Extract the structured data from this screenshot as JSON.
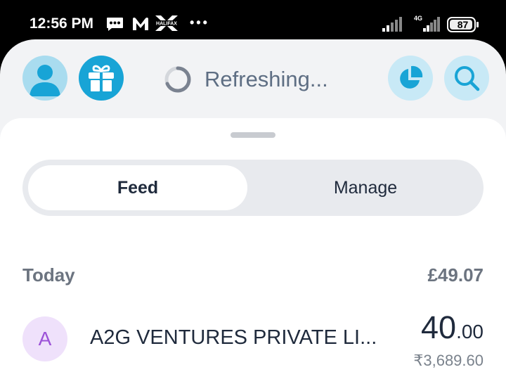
{
  "status_bar": {
    "time": "12:56 PM",
    "battery_level": "87",
    "network_type": "4G",
    "icons": [
      "message-icon",
      "m-app-icon",
      "halifax-icon",
      "more-dots-icon",
      "signal-icon",
      "signal-4g-icon",
      "battery-icon"
    ],
    "halifax_label": "HALIFAX",
    "more_label": "•••"
  },
  "header": {
    "refresh_text": "Refreshing...",
    "icons": [
      "profile-icon",
      "gift-icon",
      "spinner-icon",
      "insights-pie-icon",
      "search-icon"
    ]
  },
  "tabs": {
    "feed": "Feed",
    "manage": "Manage",
    "selected": "Feed"
  },
  "feed": {
    "section_label": "Today",
    "section_total": "£49.07",
    "transactions": [
      {
        "avatar_letter": "A",
        "name": "A2G VENTURES PRIVATE LI...",
        "amount_major": "40",
        "amount_minor": ".00",
        "local_amount": "₹3,689.60"
      }
    ]
  },
  "colors": {
    "accent_blue": "#18a4d6",
    "light_blue": "#c8e9f6",
    "avatar_purple_bg": "#efe1fb",
    "avatar_purple_fg": "#9c52d8",
    "text_dark": "#1f2a3c",
    "text_muted": "#6c7480"
  }
}
